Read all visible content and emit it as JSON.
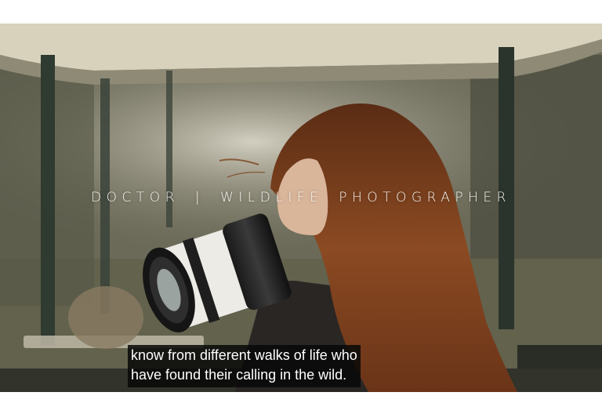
{
  "video": {
    "overlay_title": "DOCTOR | WILDLIFE PHOTOGRAPHER",
    "subtitle_lines": [
      "know from different walks of life who",
      "have found their calling in the wild."
    ]
  },
  "colors": {
    "page_background": "#ffffff",
    "subtitle_background": "#0a0a0a",
    "hair": "#7a3f1d",
    "canopy": "#d8d2bc"
  }
}
